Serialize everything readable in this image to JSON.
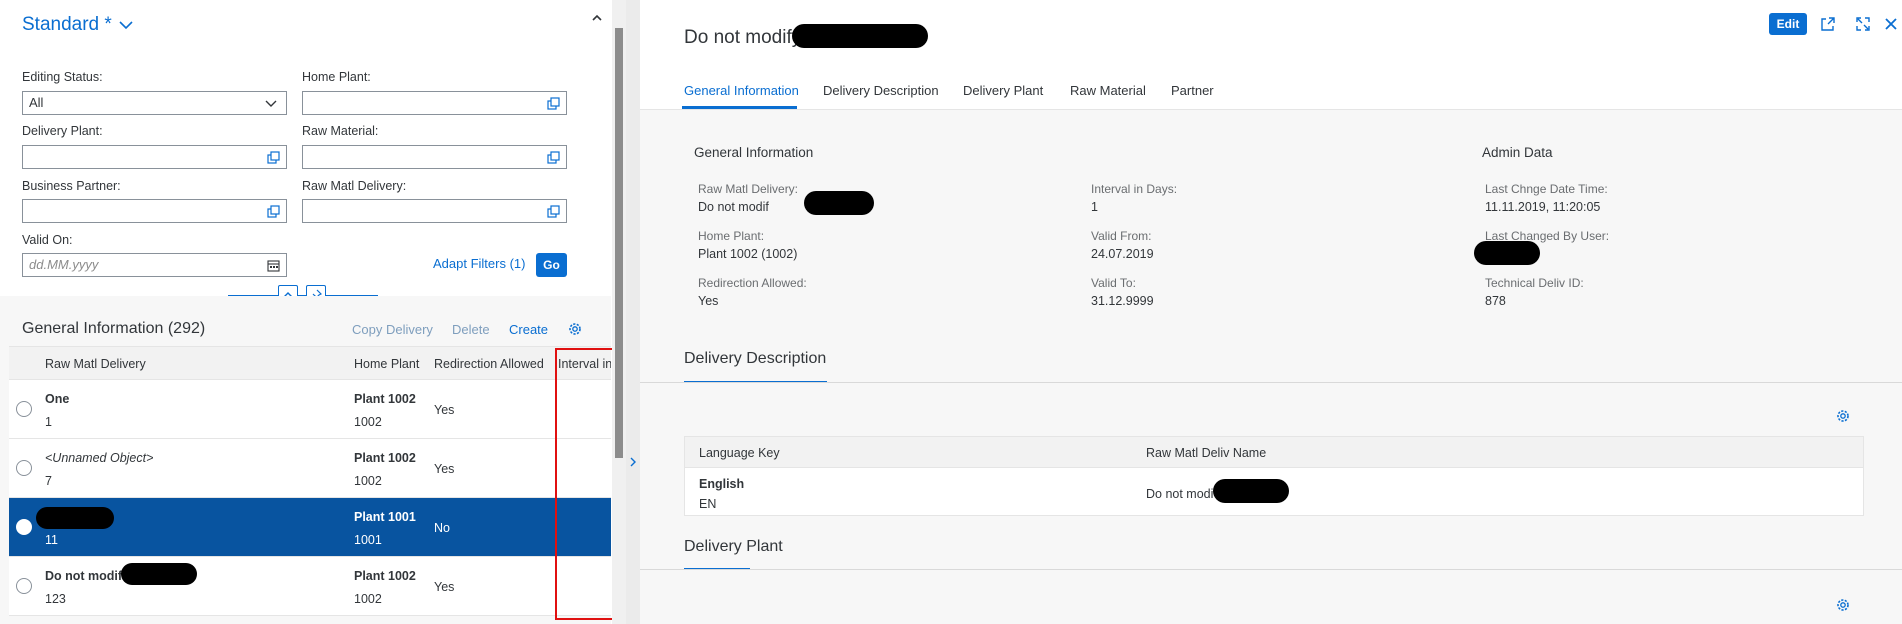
{
  "filter_bar": {
    "variant": "Standard *",
    "fields": {
      "editing_status": {
        "label": "Editing Status:",
        "value": "All"
      },
      "home_plant": {
        "label": "Home Plant:",
        "value": ""
      },
      "delivery_plant": {
        "label": "Delivery Plant:",
        "value": ""
      },
      "raw_material": {
        "label": "Raw Material:",
        "value": ""
      },
      "business_partner": {
        "label": "Business Partner:",
        "value": ""
      },
      "raw_matl_delivery": {
        "label": "Raw Matl Delivery:",
        "value": ""
      },
      "valid_on": {
        "label": "Valid On:",
        "placeholder": "dd.MM.yyyy"
      }
    },
    "adapt_filters": "Adapt Filters (1)",
    "go": "Go"
  },
  "list": {
    "title": "General Information (292)",
    "toolbar": {
      "copy": "Copy Delivery",
      "delete": "Delete",
      "create": "Create"
    },
    "columns": [
      "Raw Matl Delivery",
      "Home Plant",
      "Redirection Allowed",
      "Interval in"
    ],
    "rows": [
      {
        "name": "One",
        "id": "1",
        "plant": "Plant 1002",
        "plant_id": "1002",
        "redirection": "Yes"
      },
      {
        "name": "<Unnamed Object>",
        "id": "7",
        "plant": "Plant 1002",
        "plant_id": "1002",
        "redirection": "Yes"
      },
      {
        "name": "",
        "id": "11",
        "plant": "Plant 1001",
        "plant_id": "1001",
        "redirection": "No"
      },
      {
        "name": "Do not modif",
        "id": "123",
        "plant": "Plant 1002",
        "plant_id": "1002",
        "redirection": "Yes"
      }
    ]
  },
  "detail": {
    "title": "Do not modify",
    "actions": {
      "edit": "Edit"
    },
    "tabs": [
      "General Information",
      "Delivery Description",
      "Delivery Plant",
      "Raw Material",
      "Partner"
    ],
    "general": {
      "heading": "General Information",
      "admin_heading": "Admin Data",
      "raw_matl_delivery": {
        "label": "Raw Matl Delivery:",
        "value": "Do not modif"
      },
      "home_plant": {
        "label": "Home Plant:",
        "value": "Plant 1002 (1002)"
      },
      "redirection": {
        "label": "Redirection Allowed:",
        "value": "Yes"
      },
      "interval": {
        "label": "Interval in Days:",
        "value": "1"
      },
      "valid_from": {
        "label": "Valid From:",
        "value": "24.07.2019"
      },
      "valid_to": {
        "label": "Valid To:",
        "value": "31.12.9999"
      },
      "last_change": {
        "label": "Last Chnge Date Time:",
        "value": "11.11.2019, 11:20:05"
      },
      "last_user": {
        "label": "Last Changed By User:",
        "value": ""
      },
      "tech_id": {
        "label": "Technical Deliv ID:",
        "value": "878"
      }
    },
    "delivery_description": {
      "title": "Delivery Description",
      "columns": [
        "Language Key",
        "Raw Matl Deliv Name"
      ],
      "rows": [
        {
          "language": "English",
          "code": "EN",
          "name": "Do not modi"
        }
      ]
    },
    "delivery_plant": {
      "title": "Delivery Plant"
    }
  },
  "colors": {
    "accent": "#0a6ed1",
    "selected_row": "#0854a0",
    "highlight": "#e01010"
  }
}
